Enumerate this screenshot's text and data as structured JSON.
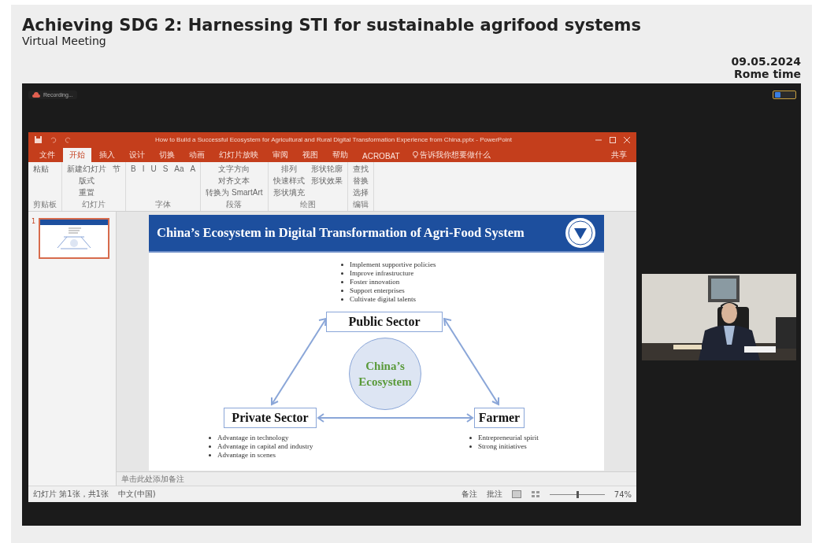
{
  "header": {
    "title": "Achieving SDG 2: Harnessing STI for sustainable agrifood systems",
    "subtitle": "Virtual Meeting",
    "date": "09.05.2024",
    "timezone": "Rome time"
  },
  "recording": {
    "label": "Recording..."
  },
  "powerpoint": {
    "title_bar": "How to Build a Successful Ecosystem for Agricultural and Rural Digital Transformation Experience from China.pptx  -  PowerPoint",
    "tabs": [
      {
        "label": "文件",
        "selected": false
      },
      {
        "label": "开始",
        "selected": true
      },
      {
        "label": "插入",
        "selected": false
      },
      {
        "label": "设计",
        "selected": false
      },
      {
        "label": "切换",
        "selected": false
      },
      {
        "label": "动画",
        "selected": false
      },
      {
        "label": "幻灯片放映",
        "selected": false
      },
      {
        "label": "审阅",
        "selected": false
      },
      {
        "label": "视图",
        "selected": false
      },
      {
        "label": "帮助",
        "selected": false
      },
      {
        "label": "ACROBAT",
        "selected": false
      }
    ],
    "search": {
      "placeholder": "告诉我你想要做什么"
    },
    "share": "共享",
    "ribbon_groups": [
      {
        "name": "剪贴板",
        "buttons": [
          "粘贴"
        ]
      },
      {
        "name": "幻灯片",
        "buttons": [
          "新建幻灯片",
          "版式",
          "重置",
          "节"
        ]
      },
      {
        "name": "字体",
        "buttons": [
          "B",
          "I",
          "U",
          "S",
          "Aa",
          "A"
        ]
      },
      {
        "name": "段落",
        "buttons": [
          "文字方向",
          "对齐文本",
          "转换为 SmartArt"
        ]
      },
      {
        "name": "绘图",
        "buttons": [
          "排列",
          "快速样式",
          "形状填充",
          "形状轮廓",
          "形状效果"
        ]
      },
      {
        "name": "编辑",
        "buttons": [
          "查找",
          "替换",
          "选择"
        ]
      }
    ],
    "slide_number": "1",
    "notes_placeholder": "单击此处添加备注",
    "status": {
      "slide_info": "幻灯片 第1张，共1张",
      "language": "中文(中国)",
      "notes": "备注",
      "comments": "批注",
      "zoom": "74%",
      "zoom_slider": {
        "level": 0.5
      }
    }
  },
  "slide": {
    "title": "China’s Ecosystem in Digital Transformation of Agri-Food System",
    "center": "China’s Ecosystem",
    "nodes": [
      {
        "label": "Public Sector",
        "bullets": [
          "Implement supportive policies",
          "Improve infrastructure",
          "Foster innovation",
          "Support enterprises",
          "Cultivate digital talents"
        ]
      },
      {
        "label": "Private Sector",
        "bullets": [
          "Advantage in technology",
          "Advantage in capital and industry",
          "Advantage in scenes"
        ]
      },
      {
        "label": "Farmer",
        "bullets": [
          "Entrepreneurial spirit",
          "Strong initiatives"
        ]
      }
    ]
  }
}
